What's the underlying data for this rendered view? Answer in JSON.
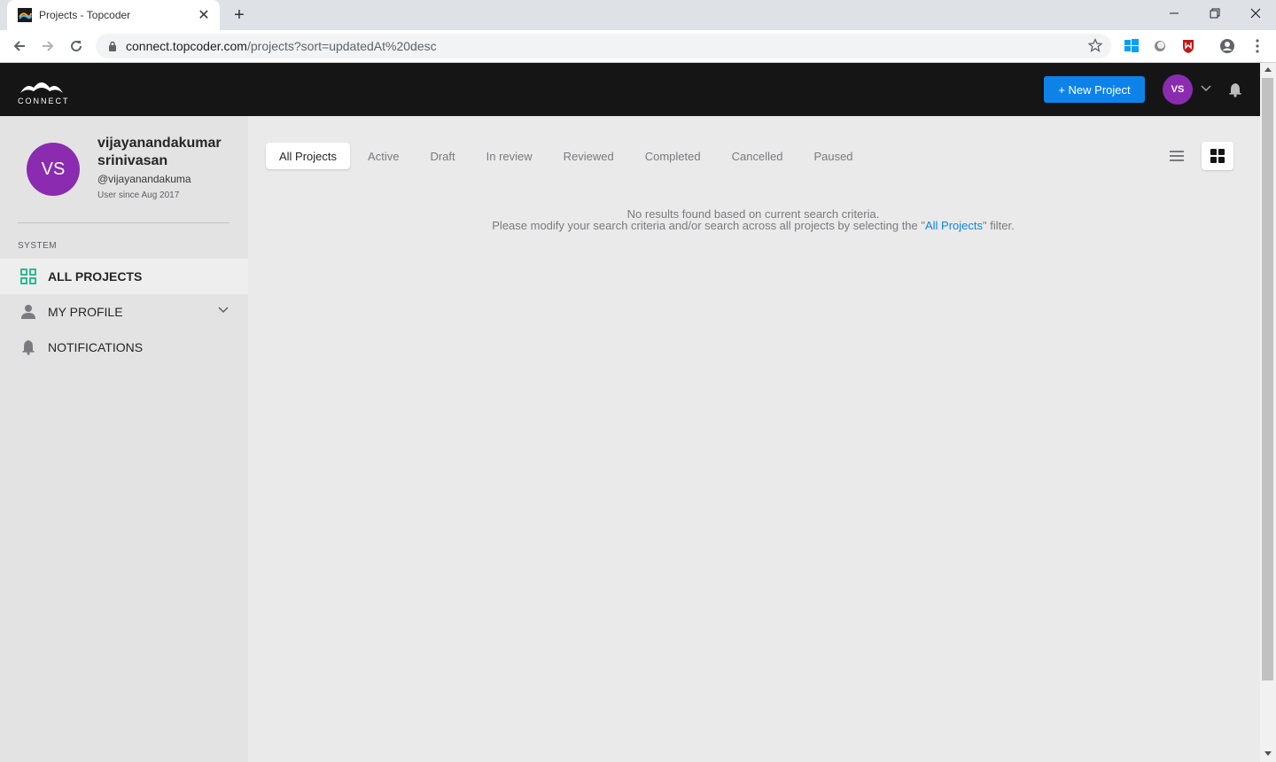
{
  "browser": {
    "tab_title": "Projects - Topcoder",
    "url_host": "connect.topcoder.com",
    "url_path": "/projects?sort=updatedAt%20desc"
  },
  "header": {
    "logo_text": "CONNECT",
    "new_project_label": "+ New Project",
    "avatar_initials": "VS"
  },
  "profile": {
    "initials": "VS",
    "name": "vijayanandakumar srinivasan",
    "handle": "@vijayanandakuma",
    "since": "User since Aug 2017"
  },
  "sidebar": {
    "section_label": "SYSTEM",
    "items": [
      {
        "label": "ALL PROJECTS",
        "icon": "grid-icon"
      },
      {
        "label": "MY PROFILE",
        "icon": "person-icon"
      },
      {
        "label": "NOTIFICATIONS",
        "icon": "bell-icon"
      }
    ]
  },
  "filters": {
    "tabs": [
      "All Projects",
      "Active",
      "Draft",
      "In review",
      "Reviewed",
      "Completed",
      "Cancelled",
      "Paused"
    ],
    "active": "All Projects"
  },
  "empty": {
    "line1": "No results found based on current search criteria.",
    "line2_pre": "Please modify your search criteria and/or search across all projects by selecting the \"",
    "line2_link": "All Projects",
    "line2_post": "\" filter."
  },
  "colors": {
    "accent": "#0d83ea",
    "avatar": "#8a2bb0",
    "active_icon": "#1bb38b"
  }
}
